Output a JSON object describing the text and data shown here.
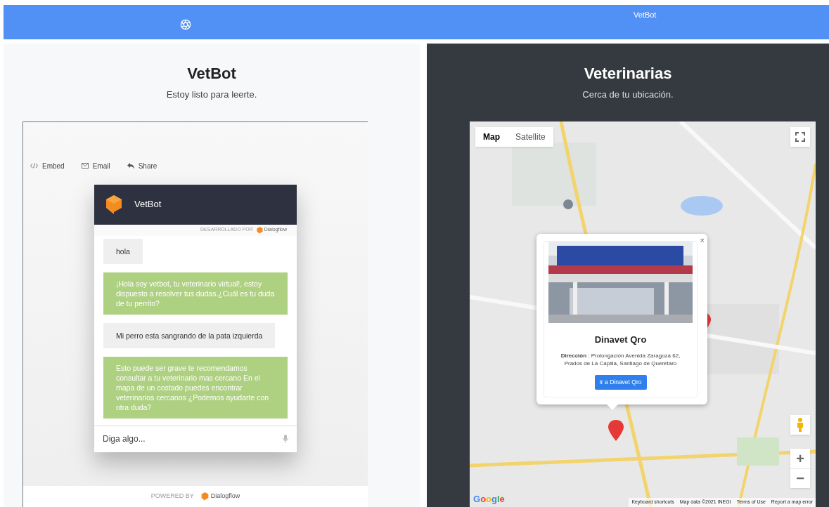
{
  "top_bar": {
    "title": "VetBot"
  },
  "chat_panel": {
    "title": "VetBot",
    "subtitle": "Estoy listo para leerte.",
    "toolbar": [
      {
        "kind": "embed",
        "label": "Embed"
      },
      {
        "kind": "email",
        "label": "Email"
      },
      {
        "kind": "share",
        "label": "Share"
      }
    ],
    "widget": {
      "title": "VetBot",
      "developed_by": "DESARROLLADO POR",
      "developed_brand": "Dialogflow",
      "messages": [
        {
          "kind": "user",
          "text": "hola"
        },
        {
          "kind": "bot",
          "text": "¡Hola soy vetbot, tu veterinario virtual!, estoy dispuesto a resolver tus dudas.¿Cuál es tu duda de tu perrito?"
        },
        {
          "kind": "user",
          "text": "Mi perro esta sangrando de la pata izquierda"
        },
        {
          "kind": "bot",
          "text": "Esto puede ser grave te recomendamos consultar a tu veterinario mas cercano En el mapa de un costado puedes encontrar veterinarios cercanos ¿Podemos ayudarte con otra duda?"
        }
      ],
      "input": {
        "placeholder": "Diga algo..."
      }
    },
    "powered_by": "POWERED BY",
    "powered_brand": "Dialogflow"
  },
  "map_panel": {
    "title": "Veterinarias",
    "subtitle": "Cerca de tu ubicación.",
    "map_types": [
      {
        "label": "Map",
        "selected": true
      },
      {
        "label": "Satellite",
        "selected": false
      }
    ],
    "popup": {
      "close": "×",
      "title": "Dinavet Qro",
      "address": "**Dirección** : Prolongación Avenida Zaragoza 62, Prados de La Capilla, Santiago de Querétaro",
      "button": "Ir a Dinavet Qro"
    },
    "zoom_in": "+",
    "zoom_out": "−",
    "logo": "Google",
    "attribution": [
      "Keyboard shortcuts",
      "Map data ©2021 INEGI",
      "Terms of Use",
      "Report a map error"
    ]
  }
}
